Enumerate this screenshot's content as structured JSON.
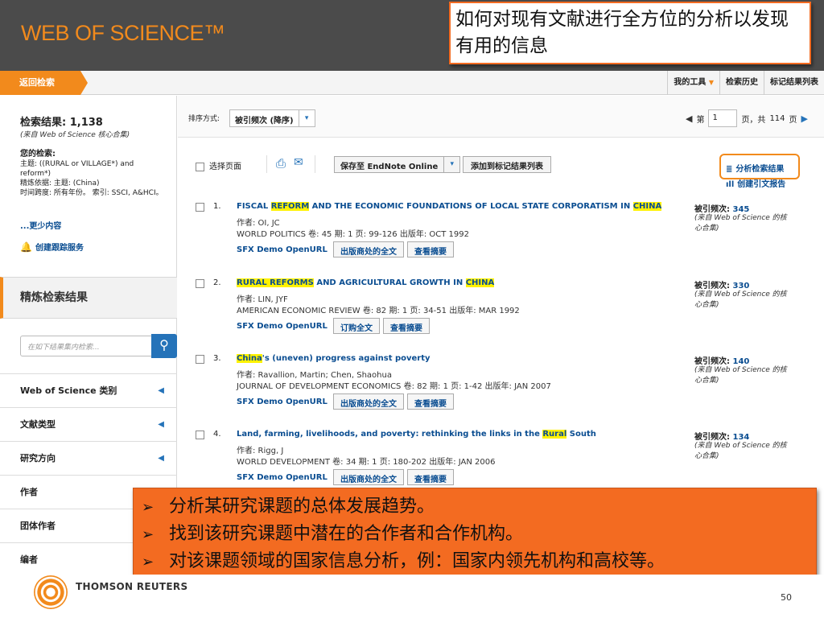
{
  "header": {
    "logo": "WEB OF SCIENCE™",
    "callout": "如何对现有文献进行全方位的分析以发现有用的信息"
  },
  "nav": {
    "back": "返回检索",
    "my_tools": "我的工具",
    "history": "检索历史",
    "marked_list": "标记结果列表"
  },
  "sidebar": {
    "results_label": "检索结果: 1,138",
    "results_source": "(来自 Web of Science 核心合集)",
    "your_search_label": "您的检索:",
    "query_line1": "主题: ((RURAL or VILLAGE*) and reform*)",
    "query_line2": "精炼依据: 主题: (China)",
    "query_line3": "时间跨度: 所有年份。 索引: SSCI, A&HCI。",
    "more": "...更少内容",
    "track": "创建跟踪服务",
    "refine": "精炼检索结果",
    "refine_placeholder": "在如下结果集内检索...",
    "facets": [
      "Web of Science 类别",
      "文献类型",
      "研究方向",
      "作者",
      "团体作者",
      "编者"
    ]
  },
  "sortbar": {
    "label": "排序方式:",
    "value": "被引频次 (降序)",
    "page_prefix": "第",
    "page": "1",
    "page_suffix": "页，共",
    "total_pages": "114",
    "page_unit": "页"
  },
  "toolbar": {
    "select_page": "选择页面",
    "save": "保存至 EndNote Online",
    "add_marked": "添加到标记结果列表",
    "analyze": "分析检索结果",
    "cite_report": "创建引文报告"
  },
  "records": [
    {
      "num": "1.",
      "title_parts": [
        "FISCAL ",
        "REFORM",
        " AND THE ECONOMIC FOUNDATIONS OF LOCAL STATE CORPORATISM IN ",
        "CHINA",
        ""
      ],
      "authors": "作者: OI, JC",
      "source": "WORLD POLITICS  卷: 45  期: 1  页: 99-126  出版年: OCT 1992",
      "sfx": "SFX Demo OpenURL Link",
      "btn1": "出版商处的全文",
      "btn2": "查看摘要",
      "cites_label": "被引频次: ",
      "cites": "345",
      "note": "(来自 Web of Science 的核心合集)"
    },
    {
      "num": "2.",
      "title_parts": [
        "",
        "RURAL REFORMS",
        " AND AGRICULTURAL GROWTH IN ",
        "CHINA",
        ""
      ],
      "authors": "作者: LIN, JYF",
      "source": "AMERICAN ECONOMIC REVIEW  卷: 82  期: 1  页: 34-51  出版年: MAR 1992",
      "sfx": "SFX Demo OpenURL Link",
      "btn1": "订购全文",
      "btn2": "查看摘要",
      "cites_label": "被引频次: ",
      "cites": "330",
      "note": "(来自 Web of Science 的核心合集)"
    },
    {
      "num": "3.",
      "title_parts": [
        "",
        "China",
        "'s (uneven) progress against poverty",
        "",
        ""
      ],
      "authors": "作者: Ravallion, Martin; Chen, Shaohua",
      "source": "JOURNAL OF DEVELOPMENT ECONOMICS  卷: 82  期: 1  页: 1-42  出版年: JAN 2007",
      "sfx": "SFX Demo OpenURL Link",
      "btn1": "出版商处的全文",
      "btn2": "查看摘要",
      "cites_label": "被引频次: ",
      "cites": "140",
      "note": "(来自 Web of Science 的核心合集)"
    },
    {
      "num": "4.",
      "title_parts": [
        "Land, farming, livelihoods, and poverty: rethinking the links in the ",
        "Rural",
        " South",
        "",
        ""
      ],
      "authors": "作者: Rigg, J",
      "source": "WORLD DEVELOPMENT  卷: 34  期: 1  页: 180-202  出版年: JAN 2006",
      "sfx": "SFX Demo OpenURL Link",
      "btn1": "出版商处的全文",
      "btn2": "查看摘要",
      "cites_label": "被引频次: ",
      "cites": "134",
      "note": "(来自 Web of Science 的核心合集)"
    }
  ],
  "bullets": [
    "分析某研究课题的总体发展趋势。",
    "找到该研究课题中潜在的合作者和合作机构。",
    "对该课题领域的国家信息分析，例：国家内领先机构和高校等。"
  ],
  "footer": {
    "brand": "THOMSON REUTERS",
    "page_number": "50"
  },
  "colors": {
    "accent": "#f28a1c",
    "callout": "#f36b21",
    "link": "#0a4d91",
    "highlight": "#fff200"
  }
}
